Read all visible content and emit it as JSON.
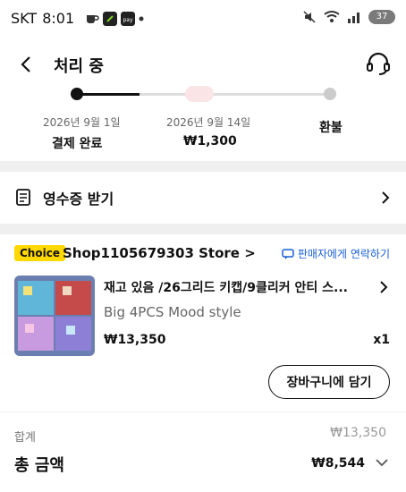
{
  "statusbar": {
    "carrier": "SKT",
    "time": "8:01",
    "battery": "37"
  },
  "header": {
    "title": "처리 중"
  },
  "steps": [
    {
      "date": "2026년 9월 1일",
      "label": "결제 완료"
    },
    {
      "date": "2026년 9월 14일",
      "label": "₩1,300"
    },
    {
      "date": "",
      "label": "환불"
    }
  ],
  "progress": {
    "completed_fraction": 0.25
  },
  "receipt": {
    "label": "영수증 받기"
  },
  "order": {
    "badge": "Choice",
    "store": "Shop1105679303 Store >",
    "contact": "판매자에게 연락하기",
    "product_title": "재고 있음 /26그리드 키캡/9클리커 안티 스...",
    "product_variant": "Big 4PCS Mood style",
    "price": "₩13,350",
    "quantity": "x1",
    "cart_button": "장바구니에 담기"
  },
  "summary": {
    "sum_label": "합계",
    "sum_value": "₩13,350",
    "total_label": "총 금액",
    "total_value": "₩8,544"
  },
  "colors": {
    "accent_link": "#1a5fd6",
    "badge": "#ffd800"
  }
}
